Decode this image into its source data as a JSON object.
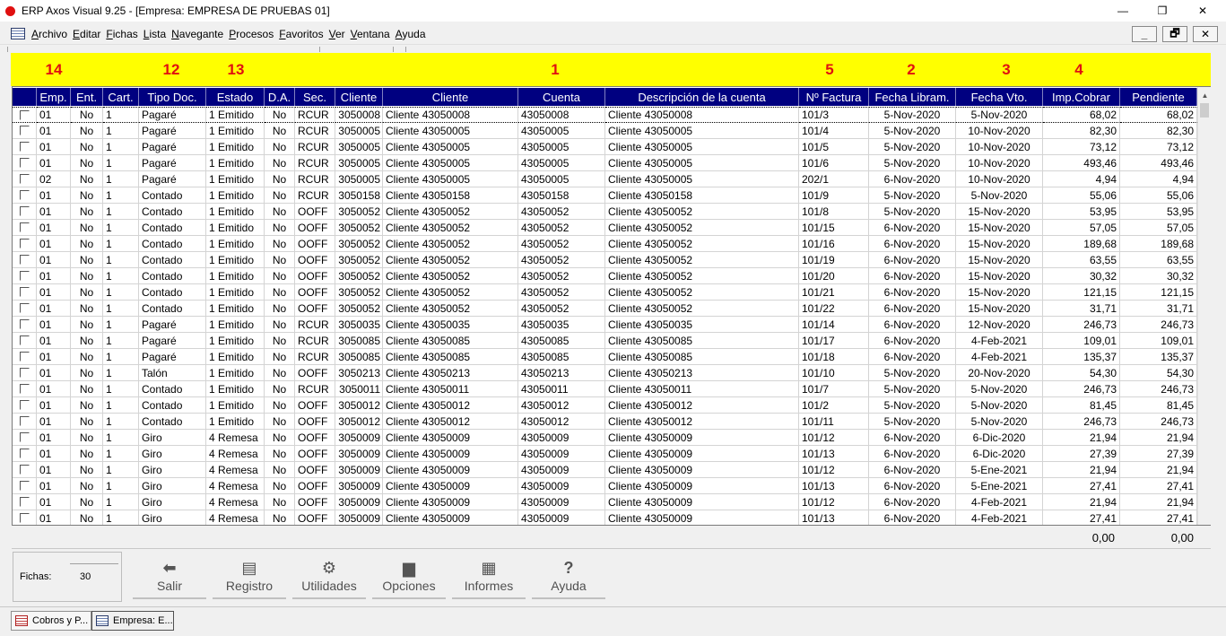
{
  "window": {
    "title": "ERP Axos Visual 9.25 - [Empresa: EMPRESA DE PRUEBAS 01]",
    "min_glyph": "—",
    "restore_glyph": "❐",
    "close_glyph": "✕"
  },
  "menu": {
    "items": [
      {
        "label": "Archivo",
        "u": "A",
        "rest": "rchivo"
      },
      {
        "label": "Editar",
        "u": "E",
        "rest": "ditar"
      },
      {
        "label": "Fichas",
        "u": "F",
        "rest": "ichas"
      },
      {
        "label": "Lista",
        "u": "L",
        "rest": "ista"
      },
      {
        "label": "Navegante",
        "u": "N",
        "rest": "avegante"
      },
      {
        "label": "Procesos",
        "u": "P",
        "rest": "rocesos"
      },
      {
        "label": "Favoritos",
        "u": "F",
        "rest": "avoritos"
      },
      {
        "label": "Ver",
        "u": "V",
        "rest": "er"
      },
      {
        "label": "Ventana",
        "u": "V",
        "rest": "entana"
      },
      {
        "label": "Ayuda",
        "u": "A",
        "rest": "yuda"
      }
    ],
    "mdi_min": "_",
    "mdi_restore": "🗗",
    "mdi_close": "✕"
  },
  "annotations": [
    "14",
    "12",
    "13",
    "1",
    "5",
    "2",
    "3",
    "4"
  ],
  "grid": {
    "columns": [
      "",
      "Emp.",
      "Ent.",
      "Cart.",
      "Tipo Doc.",
      "Estado",
      "D.A.",
      "Sec.",
      "Cliente",
      "Cliente",
      "Cuenta",
      "Descripción de la cuenta",
      "Nº Factura",
      "Fecha Libram.",
      "Fecha Vto.",
      "Imp.Cobrar",
      "Pendiente"
    ],
    "rows": [
      [
        "01",
        "No",
        "1",
        "Pagaré",
        "1 Emitido",
        "No",
        "RCUR",
        "3050008",
        "Cliente 43050008",
        "43050008",
        "Cliente 43050008",
        "101/3",
        "5-Nov-2020",
        "5-Nov-2020",
        "68,02",
        "68,02"
      ],
      [
        "01",
        "No",
        "1",
        "Pagaré",
        "1 Emitido",
        "No",
        "RCUR",
        "3050005",
        "Cliente 43050005",
        "43050005",
        "Cliente 43050005",
        "101/4",
        "5-Nov-2020",
        "10-Nov-2020",
        "82,30",
        "82,30"
      ],
      [
        "01",
        "No",
        "1",
        "Pagaré",
        "1 Emitido",
        "No",
        "RCUR",
        "3050005",
        "Cliente 43050005",
        "43050005",
        "Cliente 43050005",
        "101/5",
        "5-Nov-2020",
        "10-Nov-2020",
        "73,12",
        "73,12"
      ],
      [
        "01",
        "No",
        "1",
        "Pagaré",
        "1 Emitido",
        "No",
        "RCUR",
        "3050005",
        "Cliente 43050005",
        "43050005",
        "Cliente 43050005",
        "101/6",
        "5-Nov-2020",
        "10-Nov-2020",
        "493,46",
        "493,46"
      ],
      [
        "02",
        "No",
        "1",
        "Pagaré",
        "1 Emitido",
        "No",
        "RCUR",
        "3050005",
        "Cliente 43050005",
        "43050005",
        "Cliente 43050005",
        "202/1",
        "6-Nov-2020",
        "10-Nov-2020",
        "4,94",
        "4,94"
      ],
      [
        "01",
        "No",
        "1",
        "Contado",
        "1 Emitido",
        "No",
        "RCUR",
        "3050158",
        "Cliente 43050158",
        "43050158",
        "Cliente 43050158",
        "101/9",
        "5-Nov-2020",
        "5-Nov-2020",
        "55,06",
        "55,06"
      ],
      [
        "01",
        "No",
        "1",
        "Contado",
        "1 Emitido",
        "No",
        "OOFF",
        "3050052",
        "Cliente 43050052",
        "43050052",
        "Cliente 43050052",
        "101/8",
        "5-Nov-2020",
        "15-Nov-2020",
        "53,95",
        "53,95"
      ],
      [
        "01",
        "No",
        "1",
        "Contado",
        "1 Emitido",
        "No",
        "OOFF",
        "3050052",
        "Cliente 43050052",
        "43050052",
        "Cliente 43050052",
        "101/15",
        "6-Nov-2020",
        "15-Nov-2020",
        "57,05",
        "57,05"
      ],
      [
        "01",
        "No",
        "1",
        "Contado",
        "1 Emitido",
        "No",
        "OOFF",
        "3050052",
        "Cliente 43050052",
        "43050052",
        "Cliente 43050052",
        "101/16",
        "6-Nov-2020",
        "15-Nov-2020",
        "189,68",
        "189,68"
      ],
      [
        "01",
        "No",
        "1",
        "Contado",
        "1 Emitido",
        "No",
        "OOFF",
        "3050052",
        "Cliente 43050052",
        "43050052",
        "Cliente 43050052",
        "101/19",
        "6-Nov-2020",
        "15-Nov-2020",
        "63,55",
        "63,55"
      ],
      [
        "01",
        "No",
        "1",
        "Contado",
        "1 Emitido",
        "No",
        "OOFF",
        "3050052",
        "Cliente 43050052",
        "43050052",
        "Cliente 43050052",
        "101/20",
        "6-Nov-2020",
        "15-Nov-2020",
        "30,32",
        "30,32"
      ],
      [
        "01",
        "No",
        "1",
        "Contado",
        "1 Emitido",
        "No",
        "OOFF",
        "3050052",
        "Cliente 43050052",
        "43050052",
        "Cliente 43050052",
        "101/21",
        "6-Nov-2020",
        "15-Nov-2020",
        "121,15",
        "121,15"
      ],
      [
        "01",
        "No",
        "1",
        "Contado",
        "1 Emitido",
        "No",
        "OOFF",
        "3050052",
        "Cliente 43050052",
        "43050052",
        "Cliente 43050052",
        "101/22",
        "6-Nov-2020",
        "15-Nov-2020",
        "31,71",
        "31,71"
      ],
      [
        "01",
        "No",
        "1",
        "Pagaré",
        "1 Emitido",
        "No",
        "RCUR",
        "3050035",
        "Cliente 43050035",
        "43050035",
        "Cliente 43050035",
        "101/14",
        "6-Nov-2020",
        "12-Nov-2020",
        "246,73",
        "246,73"
      ],
      [
        "01",
        "No",
        "1",
        "Pagaré",
        "1 Emitido",
        "No",
        "RCUR",
        "3050085",
        "Cliente 43050085",
        "43050085",
        "Cliente 43050085",
        "101/17",
        "6-Nov-2020",
        "4-Feb-2021",
        "109,01",
        "109,01"
      ],
      [
        "01",
        "No",
        "1",
        "Pagaré",
        "1 Emitido",
        "No",
        "RCUR",
        "3050085",
        "Cliente 43050085",
        "43050085",
        "Cliente 43050085",
        "101/18",
        "6-Nov-2020",
        "4-Feb-2021",
        "135,37",
        "135,37"
      ],
      [
        "01",
        "No",
        "1",
        "Talón",
        "1 Emitido",
        "No",
        "OOFF",
        "3050213",
        "Cliente 43050213",
        "43050213",
        "Cliente 43050213",
        "101/10",
        "5-Nov-2020",
        "20-Nov-2020",
        "54,30",
        "54,30"
      ],
      [
        "01",
        "No",
        "1",
        "Contado",
        "1 Emitido",
        "No",
        "RCUR",
        "3050011",
        "Cliente 43050011",
        "43050011",
        "Cliente 43050011",
        "101/7",
        "5-Nov-2020",
        "5-Nov-2020",
        "246,73",
        "246,73"
      ],
      [
        "01",
        "No",
        "1",
        "Contado",
        "1 Emitido",
        "No",
        "OOFF",
        "3050012",
        "Cliente 43050012",
        "43050012",
        "Cliente 43050012",
        "101/2",
        "5-Nov-2020",
        "5-Nov-2020",
        "81,45",
        "81,45"
      ],
      [
        "01",
        "No",
        "1",
        "Contado",
        "1 Emitido",
        "No",
        "OOFF",
        "3050012",
        "Cliente 43050012",
        "43050012",
        "Cliente 43050012",
        "101/11",
        "5-Nov-2020",
        "5-Nov-2020",
        "246,73",
        "246,73"
      ],
      [
        "01",
        "No",
        "1",
        "Giro",
        "4 Remesa",
        "No",
        "OOFF",
        "3050009",
        "Cliente 43050009",
        "43050009",
        "Cliente 43050009",
        "101/12",
        "6-Nov-2020",
        "6-Dic-2020",
        "21,94",
        "21,94"
      ],
      [
        "01",
        "No",
        "1",
        "Giro",
        "4 Remesa",
        "No",
        "OOFF",
        "3050009",
        "Cliente 43050009",
        "43050009",
        "Cliente 43050009",
        "101/13",
        "6-Nov-2020",
        "6-Dic-2020",
        "27,39",
        "27,39"
      ],
      [
        "01",
        "No",
        "1",
        "Giro",
        "4 Remesa",
        "No",
        "OOFF",
        "3050009",
        "Cliente 43050009",
        "43050009",
        "Cliente 43050009",
        "101/12",
        "6-Nov-2020",
        "5-Ene-2021",
        "21,94",
        "21,94"
      ],
      [
        "01",
        "No",
        "1",
        "Giro",
        "4 Remesa",
        "No",
        "OOFF",
        "3050009",
        "Cliente 43050009",
        "43050009",
        "Cliente 43050009",
        "101/13",
        "6-Nov-2020",
        "5-Ene-2021",
        "27,41",
        "27,41"
      ],
      [
        "01",
        "No",
        "1",
        "Giro",
        "4 Remesa",
        "No",
        "OOFF",
        "3050009",
        "Cliente 43050009",
        "43050009",
        "Cliente 43050009",
        "101/12",
        "6-Nov-2020",
        "4-Feb-2021",
        "21,94",
        "21,94"
      ],
      [
        "01",
        "No",
        "1",
        "Giro",
        "4 Remesa",
        "No",
        "OOFF",
        "3050009",
        "Cliente 43050009",
        "43050009",
        "Cliente 43050009",
        "101/13",
        "6-Nov-2020",
        "4-Feb-2021",
        "27,41",
        "27,41"
      ]
    ],
    "selected_row": 0,
    "scroll_up_glyph": "▲"
  },
  "totals": {
    "imp_cobrar": "0,00",
    "pendiente": "0,00"
  },
  "fichas": {
    "label": "Fichas:",
    "value": "30"
  },
  "buttons": [
    {
      "label": "Salir",
      "icon": "exit-icon",
      "glyph": "⬅"
    },
    {
      "label": "Registro",
      "icon": "document-icon",
      "glyph": "▤"
    },
    {
      "label": "Utilidades",
      "icon": "gear-icon",
      "glyph": "⚙"
    },
    {
      "label": "Opciones",
      "icon": "briefcase-icon",
      "glyph": "▆"
    },
    {
      "label": "Informes",
      "icon": "printer-icon",
      "glyph": "▦"
    },
    {
      "label": "Ayuda",
      "icon": "question-icon",
      "glyph": "?"
    }
  ],
  "tabs": [
    {
      "label": "Cobros y P..."
    },
    {
      "label": "Empresa: E..."
    }
  ],
  "colors": {
    "header_bg": "#000080",
    "annotation_band": "#ffff00",
    "annotation_text": "#e01010"
  }
}
